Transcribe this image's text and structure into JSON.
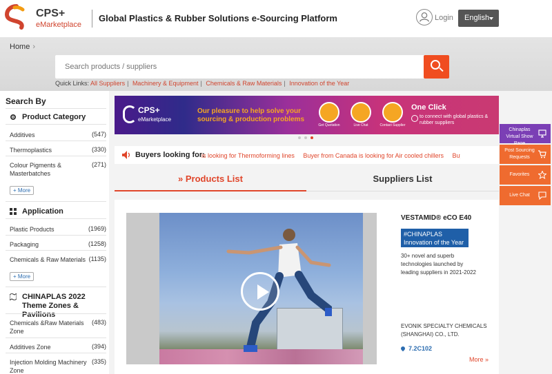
{
  "header": {
    "logo_text": "CPS+",
    "logo_sub": "eMarketplace",
    "title": "Global Plastics & Rubber Solutions e-Sourcing Platform",
    "login": "Login",
    "language": "English"
  },
  "breadcrumb": {
    "home": "Home"
  },
  "search": {
    "placeholder": "Search products / suppliers",
    "quick_links_label": "Quick Links:",
    "quick_links": [
      "All Suppliers",
      "Machinery & Equipment",
      "Chemicals & Raw Materials",
      "Innovation of the Year"
    ]
  },
  "sidebar": {
    "title": "Search By",
    "product_category": {
      "heading": "Product Category",
      "items": [
        {
          "name": "Additives",
          "count": "(547)"
        },
        {
          "name": "Thermoplastics",
          "count": "(330)"
        },
        {
          "name": "Colour Pigments & Masterbatches",
          "count": "(271)"
        }
      ],
      "more": "+ More"
    },
    "application": {
      "heading": "Application",
      "items": [
        {
          "name": "Plastic Products",
          "count": "(1969)"
        },
        {
          "name": "Packaging",
          "count": "(1258)"
        },
        {
          "name": "Chemicals & Raw Materials",
          "count": "(1135)"
        }
      ],
      "more": "+ More"
    },
    "theme_zones": {
      "heading": "CHINAPLAS 2022 Theme Zones & Pavilions",
      "items": [
        {
          "name": "Chemicals &Raw Materials Zone",
          "count": "(483)"
        },
        {
          "name": "Additives Zone",
          "count": "(394)"
        },
        {
          "name": "Injection Molding Machinery Zone",
          "count": "(335)"
        }
      ]
    }
  },
  "banner": {
    "logo_text": "CPS+",
    "logo_sub": "eMarketplace",
    "message": "Our pleasure to help solve your sourcing & production problems",
    "buttons": [
      "Get Quotation",
      "Live Chat",
      "Contact Supplier"
    ],
    "one_click": "One Click",
    "one_click_sub": "to connect with global plastics & rubber suppliers"
  },
  "buyers": {
    "label": "Buyers looking for:",
    "messages": [
      "is looking for Thermoforming lines",
      "Buyer from Canada is looking for Air cooled chillers",
      "Buy"
    ]
  },
  "tabs": {
    "products": "Products List",
    "products_prefix": "»",
    "suppliers": "Suppliers List"
  },
  "product": {
    "title": "VESTAMID® eCO E40",
    "tag": "#CHINAPLAS Innovation of the Year",
    "description": "30+ novel and superb technologies launched by leading suppliers in 2021-2022",
    "company": "EVONIK SPECIALTY CHEMICALS (SHANGHAI) CO., LTD.",
    "booth": "7.2C102",
    "more": "More »"
  },
  "floating": {
    "virtual": "Chinaplas Virtual Show Page",
    "post": "Post Sourcing Requests",
    "favorites": "Favorites",
    "chat": "Live Chat"
  },
  "colors": {
    "accent": "#e0452a",
    "search_button": "#f04d20",
    "tag_blue": "#1f5fa8",
    "float_orange": "#ef6b2f",
    "float_purple": "#7b3fb5"
  }
}
